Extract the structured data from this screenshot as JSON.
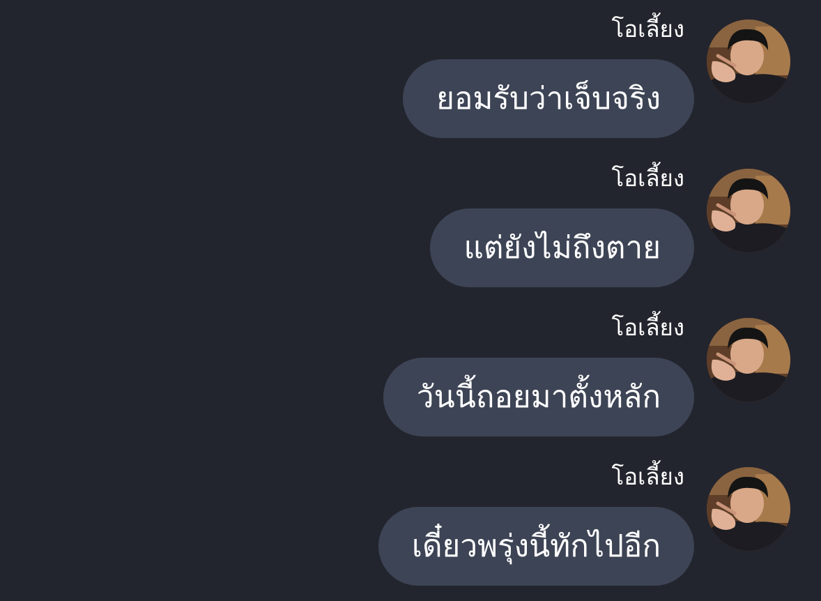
{
  "chat": {
    "messages": [
      {
        "sender": "โอเลี้ยง",
        "text": "ยอมรับว่าเจ็บจริง",
        "avatar_icon": "profile-photo"
      },
      {
        "sender": "โอเลี้ยง",
        "text": "แต่ยังไม่ถึงตาย",
        "avatar_icon": "profile-photo"
      },
      {
        "sender": "โอเลี้ยง",
        "text": "วันนี้ถอยมาตั้งหลัก",
        "avatar_icon": "profile-photo"
      },
      {
        "sender": "โอเลี้ยง",
        "text": "เดี๋ยวพรุ่งนี้ทักไปอีก",
        "avatar_icon": "profile-photo"
      }
    ]
  },
  "colors": {
    "background": "#23252e",
    "bubble": "#3d4455",
    "text": "#ffffff"
  }
}
